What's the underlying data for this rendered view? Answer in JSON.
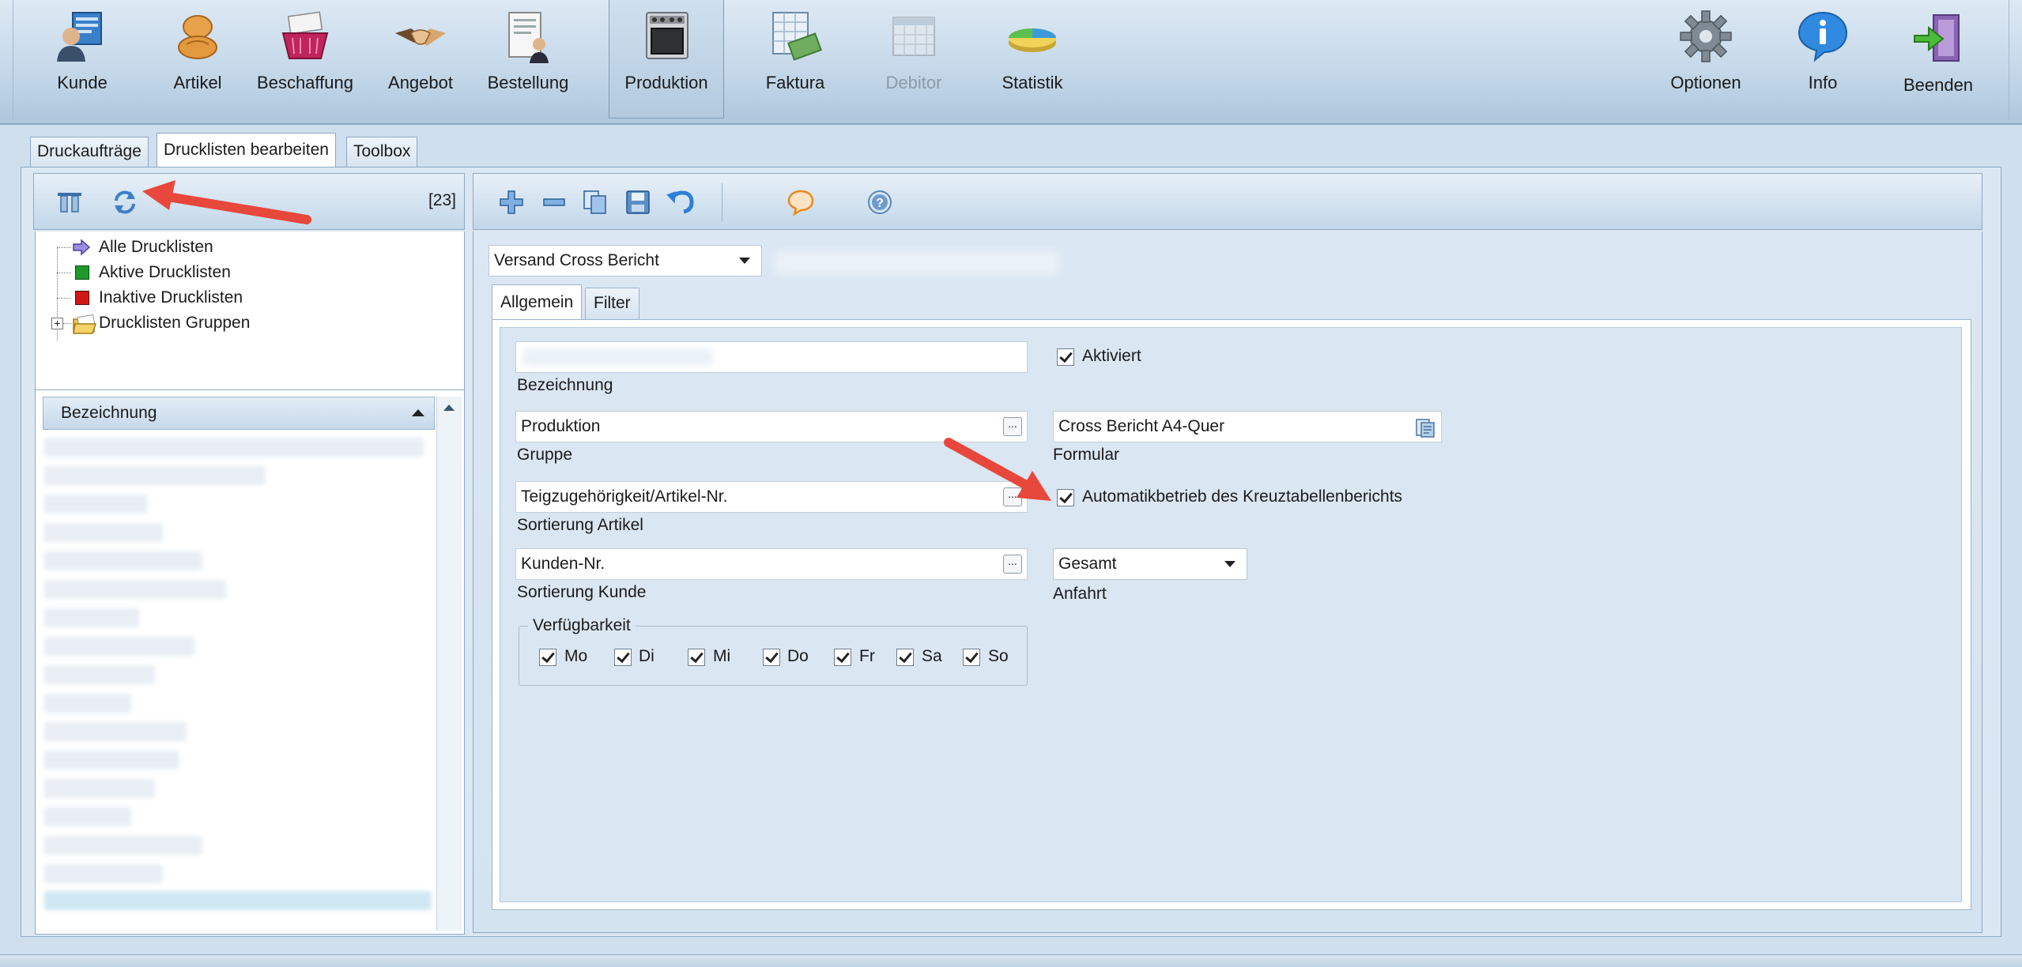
{
  "ribbon": {
    "items": [
      {
        "label": "Kunde",
        "icon": "customer-icon",
        "state": "normal"
      },
      {
        "label": "Artikel",
        "icon": "bread-icon",
        "state": "normal"
      },
      {
        "label": "Beschaffung",
        "icon": "basket-icon",
        "state": "normal"
      },
      {
        "label": "Angebot",
        "icon": "handshake-icon",
        "state": "normal"
      },
      {
        "label": "Bestellung",
        "icon": "document-person-icon",
        "state": "normal"
      },
      {
        "label": "Produktion",
        "icon": "oven-icon",
        "state": "active"
      },
      {
        "label": "Faktura",
        "icon": "invoice-icon",
        "state": "normal"
      },
      {
        "label": "Debitor",
        "icon": "calendar-icon",
        "state": "disabled"
      },
      {
        "label": "Statistik",
        "icon": "pie-chart-icon",
        "state": "normal"
      },
      {
        "label": "Optionen",
        "icon": "gear-icon",
        "state": "normal"
      },
      {
        "label": "Info",
        "icon": "info-icon",
        "state": "normal"
      },
      {
        "label": "Beenden",
        "icon": "exit-door-icon",
        "state": "normal"
      }
    ]
  },
  "outer_tabs": {
    "druckauftraege": "Druckaufträge",
    "drucklisten_bearbeiten": "Drucklisten bearbeiten",
    "toolbox": "Toolbox"
  },
  "left_panel": {
    "count": "[23]",
    "tree": {
      "alle": "Alle Drucklisten",
      "aktive": "Aktive Drucklisten",
      "inaktive": "Inaktive Drucklisten",
      "gruppen": "Drucklisten Gruppen"
    },
    "grid": {
      "column_header": "Bezeichnung"
    }
  },
  "right_panel": {
    "selected_list": "Versand Cross Bericht",
    "inner_tabs": {
      "allgemein": "Allgemein",
      "filter": "Filter"
    },
    "form": {
      "bezeichnung_label": "Bezeichnung",
      "aktiviert_label": "Aktiviert",
      "gruppe_value": "Produktion",
      "gruppe_label": "Gruppe",
      "formular_value": "Cross Bericht A4-Quer",
      "formular_label": "Formular",
      "sortierung_artikel_value": "Teigzugehörigkeit/Artikel-Nr.",
      "sortierung_artikel_label": "Sortierung Artikel",
      "automatik_label": "Automatikbetrieb des Kreuztabellenberichts",
      "sortierung_kunde_value": "Kunden-Nr.",
      "sortierung_kunde_label": "Sortierung Kunde",
      "anfahrt_value": "Gesamt",
      "anfahrt_label": "Anfahrt",
      "verfuegbarkeit_label": "Verfügbarkeit",
      "days": [
        "Mo",
        "Di",
        "Mi",
        "Do",
        "Fr",
        "Sa",
        "So"
      ],
      "ellipsis": "..."
    }
  },
  "colors": {
    "ribbon_bg": "#c6d9ea",
    "panel_bg": "#dae6f1",
    "annotation_arrow": "#e8473c",
    "aktive_green": "#1f9a2a",
    "inaktive_red": "#d01818"
  }
}
